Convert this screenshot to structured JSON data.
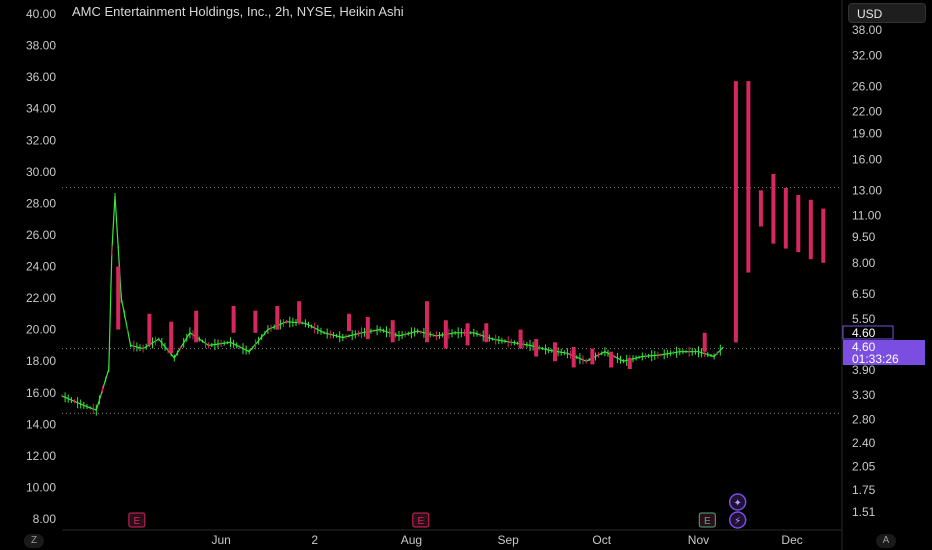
{
  "title": "AMC Entertainment Holdings, Inc., 2h, NYSE, Heikin Ashi",
  "currency_button": "USD",
  "z_button": "Z",
  "a_button": "A",
  "colors": {
    "up": "#39e639",
    "down": "#d6275e",
    "accent": "#7a4ee0",
    "grid_line": "#888888"
  },
  "event_markers": [
    {
      "label": "E",
      "icon": "earnings-icon",
      "x": "2022-05-05"
    },
    {
      "label": "E",
      "icon": "earnings-icon",
      "x": "2022-08-04"
    },
    {
      "label": "E",
      "icon": "earnings-icon",
      "x": "2022-11-08"
    },
    {
      "label": "✦",
      "icon": "spark-event-icon",
      "x": "2022-11-11"
    },
    {
      "label": "⚡",
      "icon": "lightning-event-icon",
      "x": "2022-11-11"
    }
  ],
  "price_tags": [
    {
      "text": "4.60",
      "style": "outline"
    },
    {
      "text": "4.60",
      "style": "filled"
    },
    {
      "text": "01:33:26",
      "style": "filled"
    }
  ],
  "chart_data": [
    {
      "type": "line",
      "name": "left-scale",
      "y_axis_side": "left",
      "ylim": [
        7,
        40
      ],
      "yticks": [
        "8.00",
        "10.00",
        "12.00",
        "14.00",
        "16.00",
        "18.00",
        "20.00",
        "22.00",
        "24.00",
        "26.00",
        "28.00",
        "30.00",
        "32.00",
        "34.00",
        "36.00",
        "38.00",
        "40.00"
      ],
      "x_ticks": [
        "Jun",
        "2",
        "Aug",
        "Sep",
        "Oct",
        "Nov",
        "Dec"
      ],
      "x_tick_dates": [
        "2022-06-01",
        "2022-07-01",
        "2022-08-01",
        "2022-09-01",
        "2022-10-01",
        "2022-11-01",
        "2022-12-01"
      ],
      "xlim": [
        "2022-04-11",
        "2022-12-17"
      ],
      "reference_lines": [
        29.0,
        18.8,
        14.7
      ],
      "x": [
        "2022-04-11",
        "2022-04-18",
        "2022-04-22",
        "2022-04-26",
        "2022-04-27",
        "2022-04-28",
        "2022-04-30",
        "2022-05-03",
        "2022-05-07",
        "2022-05-12",
        "2022-05-17",
        "2022-05-22",
        "2022-05-28",
        "2022-06-04",
        "2022-06-10",
        "2022-06-16",
        "2022-06-22",
        "2022-06-28",
        "2022-07-04",
        "2022-07-10",
        "2022-07-16",
        "2022-07-22",
        "2022-07-28",
        "2022-08-03",
        "2022-08-09",
        "2022-08-15",
        "2022-08-21",
        "2022-08-27",
        "2022-09-02",
        "2022-09-08",
        "2022-09-14",
        "2022-09-20",
        "2022-09-26",
        "2022-10-02",
        "2022-10-08",
        "2022-10-14",
        "2022-10-20",
        "2022-10-26",
        "2022-11-01",
        "2022-11-06",
        "2022-11-09"
      ],
      "values": [
        15.8,
        15.2,
        14.9,
        17.5,
        25.0,
        28.5,
        22.0,
        19.0,
        18.8,
        19.4,
        18.2,
        19.8,
        19.0,
        19.2,
        18.6,
        20.0,
        20.5,
        20.4,
        19.8,
        19.5,
        19.8,
        20.0,
        19.6,
        19.9,
        19.6,
        19.8,
        19.8,
        19.4,
        19.2,
        19.0,
        18.7,
        18.5,
        18.0,
        18.6,
        18.0,
        18.3,
        18.4,
        18.6,
        18.6,
        18.3,
        18.9
      ]
    },
    {
      "type": "bar",
      "name": "right-scale",
      "y_axis_side": "right",
      "scale": "log",
      "ylim": [
        1.4,
        40
      ],
      "yticks": [
        "1.51",
        "1.75",
        "2.05",
        "2.40",
        "2.80",
        "3.30",
        "3.90",
        "4.60",
        "5.50",
        "6.50",
        "8.00",
        "9.50",
        "11.00",
        "13.00",
        "16.00",
        "19.00",
        "22.00",
        "26.00",
        "32.00",
        "38.00"
      ],
      "x": [
        "2022-11-13",
        "2022-11-17",
        "2022-11-21",
        "2022-11-25",
        "2022-11-29",
        "2022-12-03",
        "2022-12-07",
        "2022-12-11"
      ],
      "series": [
        {
          "low": [
            4.7,
            7.5,
            10.2,
            9.1,
            8.8,
            8.6,
            8.2,
            8.0
          ],
          "high": [
            27.0,
            27.0,
            13.0,
            14.5,
            13.2,
            12.6,
            12.2,
            11.5
          ]
        }
      ]
    }
  ]
}
